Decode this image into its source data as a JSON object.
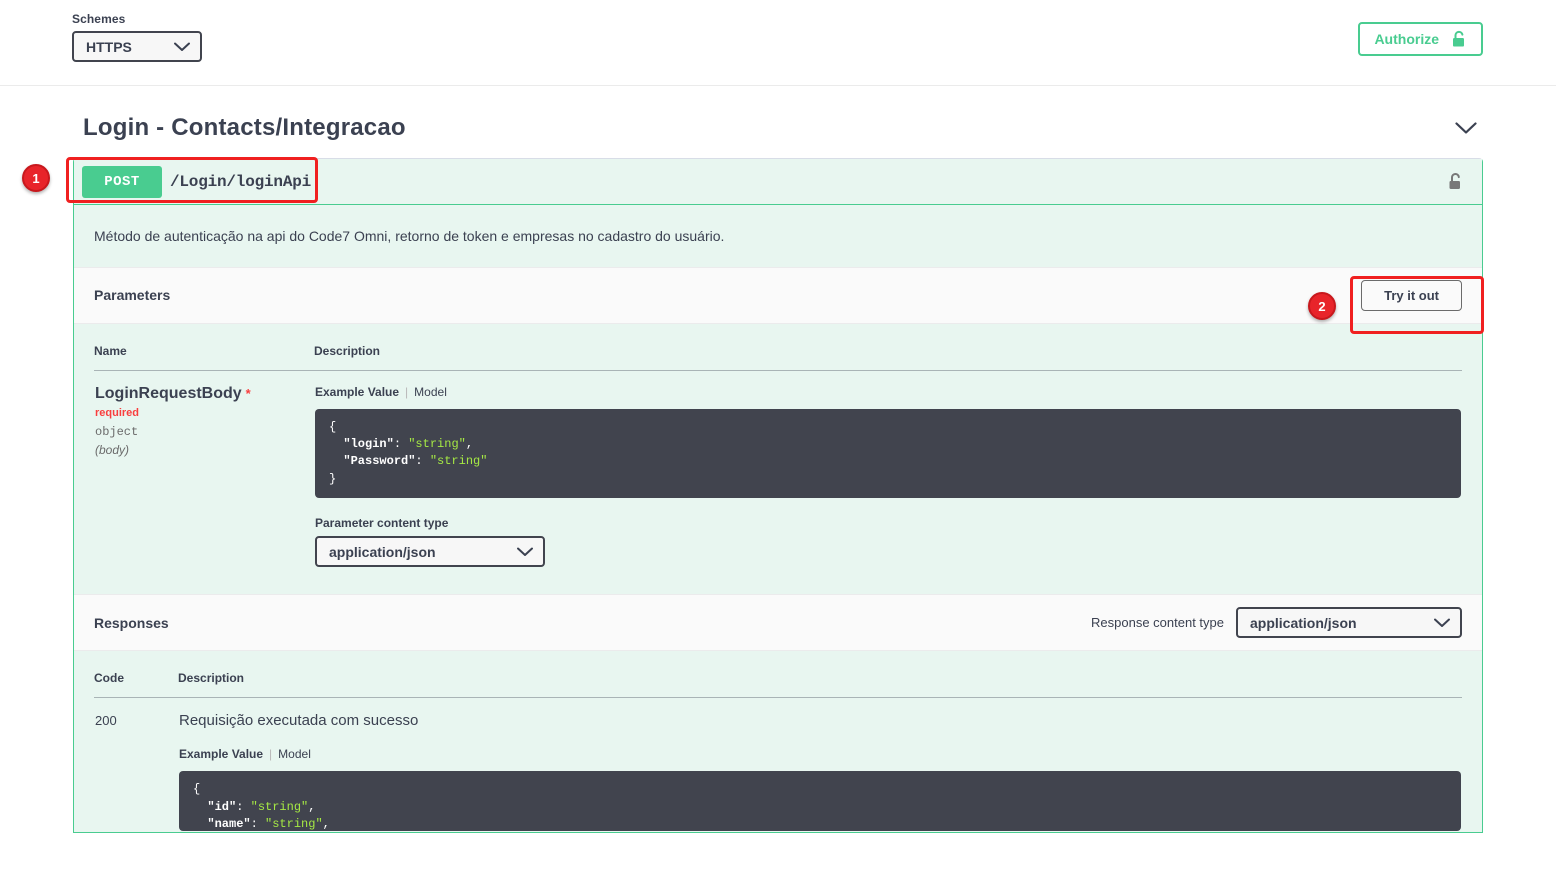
{
  "topbar": {
    "schemes_label": "Schemes",
    "scheme_value": "HTTPS",
    "authorize_label": "Authorize",
    "authorize_icon": "unlock-icon"
  },
  "tag": {
    "title": "Login - Contacts/Integracao",
    "collapse_icon": "chevron-down-icon"
  },
  "operation": {
    "method": "POST",
    "path": "/Login/loginApi",
    "lock_icon": "unlock-icon",
    "description": "Método de autenticação na api do Code7 Omni, retorno de token e empresas no cadastro do usuário."
  },
  "parameters": {
    "section_title": "Parameters",
    "try_it_out_label": "Try it out",
    "headers": [
      "Name",
      "Description"
    ],
    "rows": [
      {
        "name": "LoginRequestBody",
        "required_star": "*",
        "required_label": "required",
        "type": "object",
        "in": "(body)",
        "tab_example": "Example Value",
        "tab_model": "Model",
        "example_lines": [
          {
            "text": "{"
          },
          {
            "indent": true,
            "key": "\"login\"",
            "sep": ": ",
            "value": "\"string\"",
            "comma": ","
          },
          {
            "indent": true,
            "key": "\"Password\"",
            "sep": ": ",
            "value": "\"string\"",
            "comma": ""
          },
          {
            "text": "}"
          }
        ],
        "content_type_label": "Parameter content type",
        "content_type_value": "application/json"
      }
    ]
  },
  "responses": {
    "section_title": "Responses",
    "content_type_label": "Response content type",
    "content_type_value": "application/json",
    "headers": [
      "Code",
      "Description"
    ],
    "rows": [
      {
        "code": "200",
        "description": "Requisição executada com sucesso",
        "tab_example": "Example Value",
        "tab_model": "Model",
        "example_lines": [
          {
            "text": "{"
          },
          {
            "indent": true,
            "key": "\"id\"",
            "sep": ": ",
            "value": "\"string\"",
            "comma": ","
          }
        ]
      }
    ]
  },
  "annotations": [
    {
      "number": "1",
      "target": "post-login-operation-row"
    },
    {
      "number": "2",
      "target": "try-it-out-button"
    }
  ],
  "colors": {
    "method_green": "#49cc90",
    "opblock_bg": "#e8f6f0",
    "code_bg": "#41444e",
    "string_green": "#a5e844",
    "required_red": "#f93e3e",
    "annotation_red": "#e8242a"
  }
}
